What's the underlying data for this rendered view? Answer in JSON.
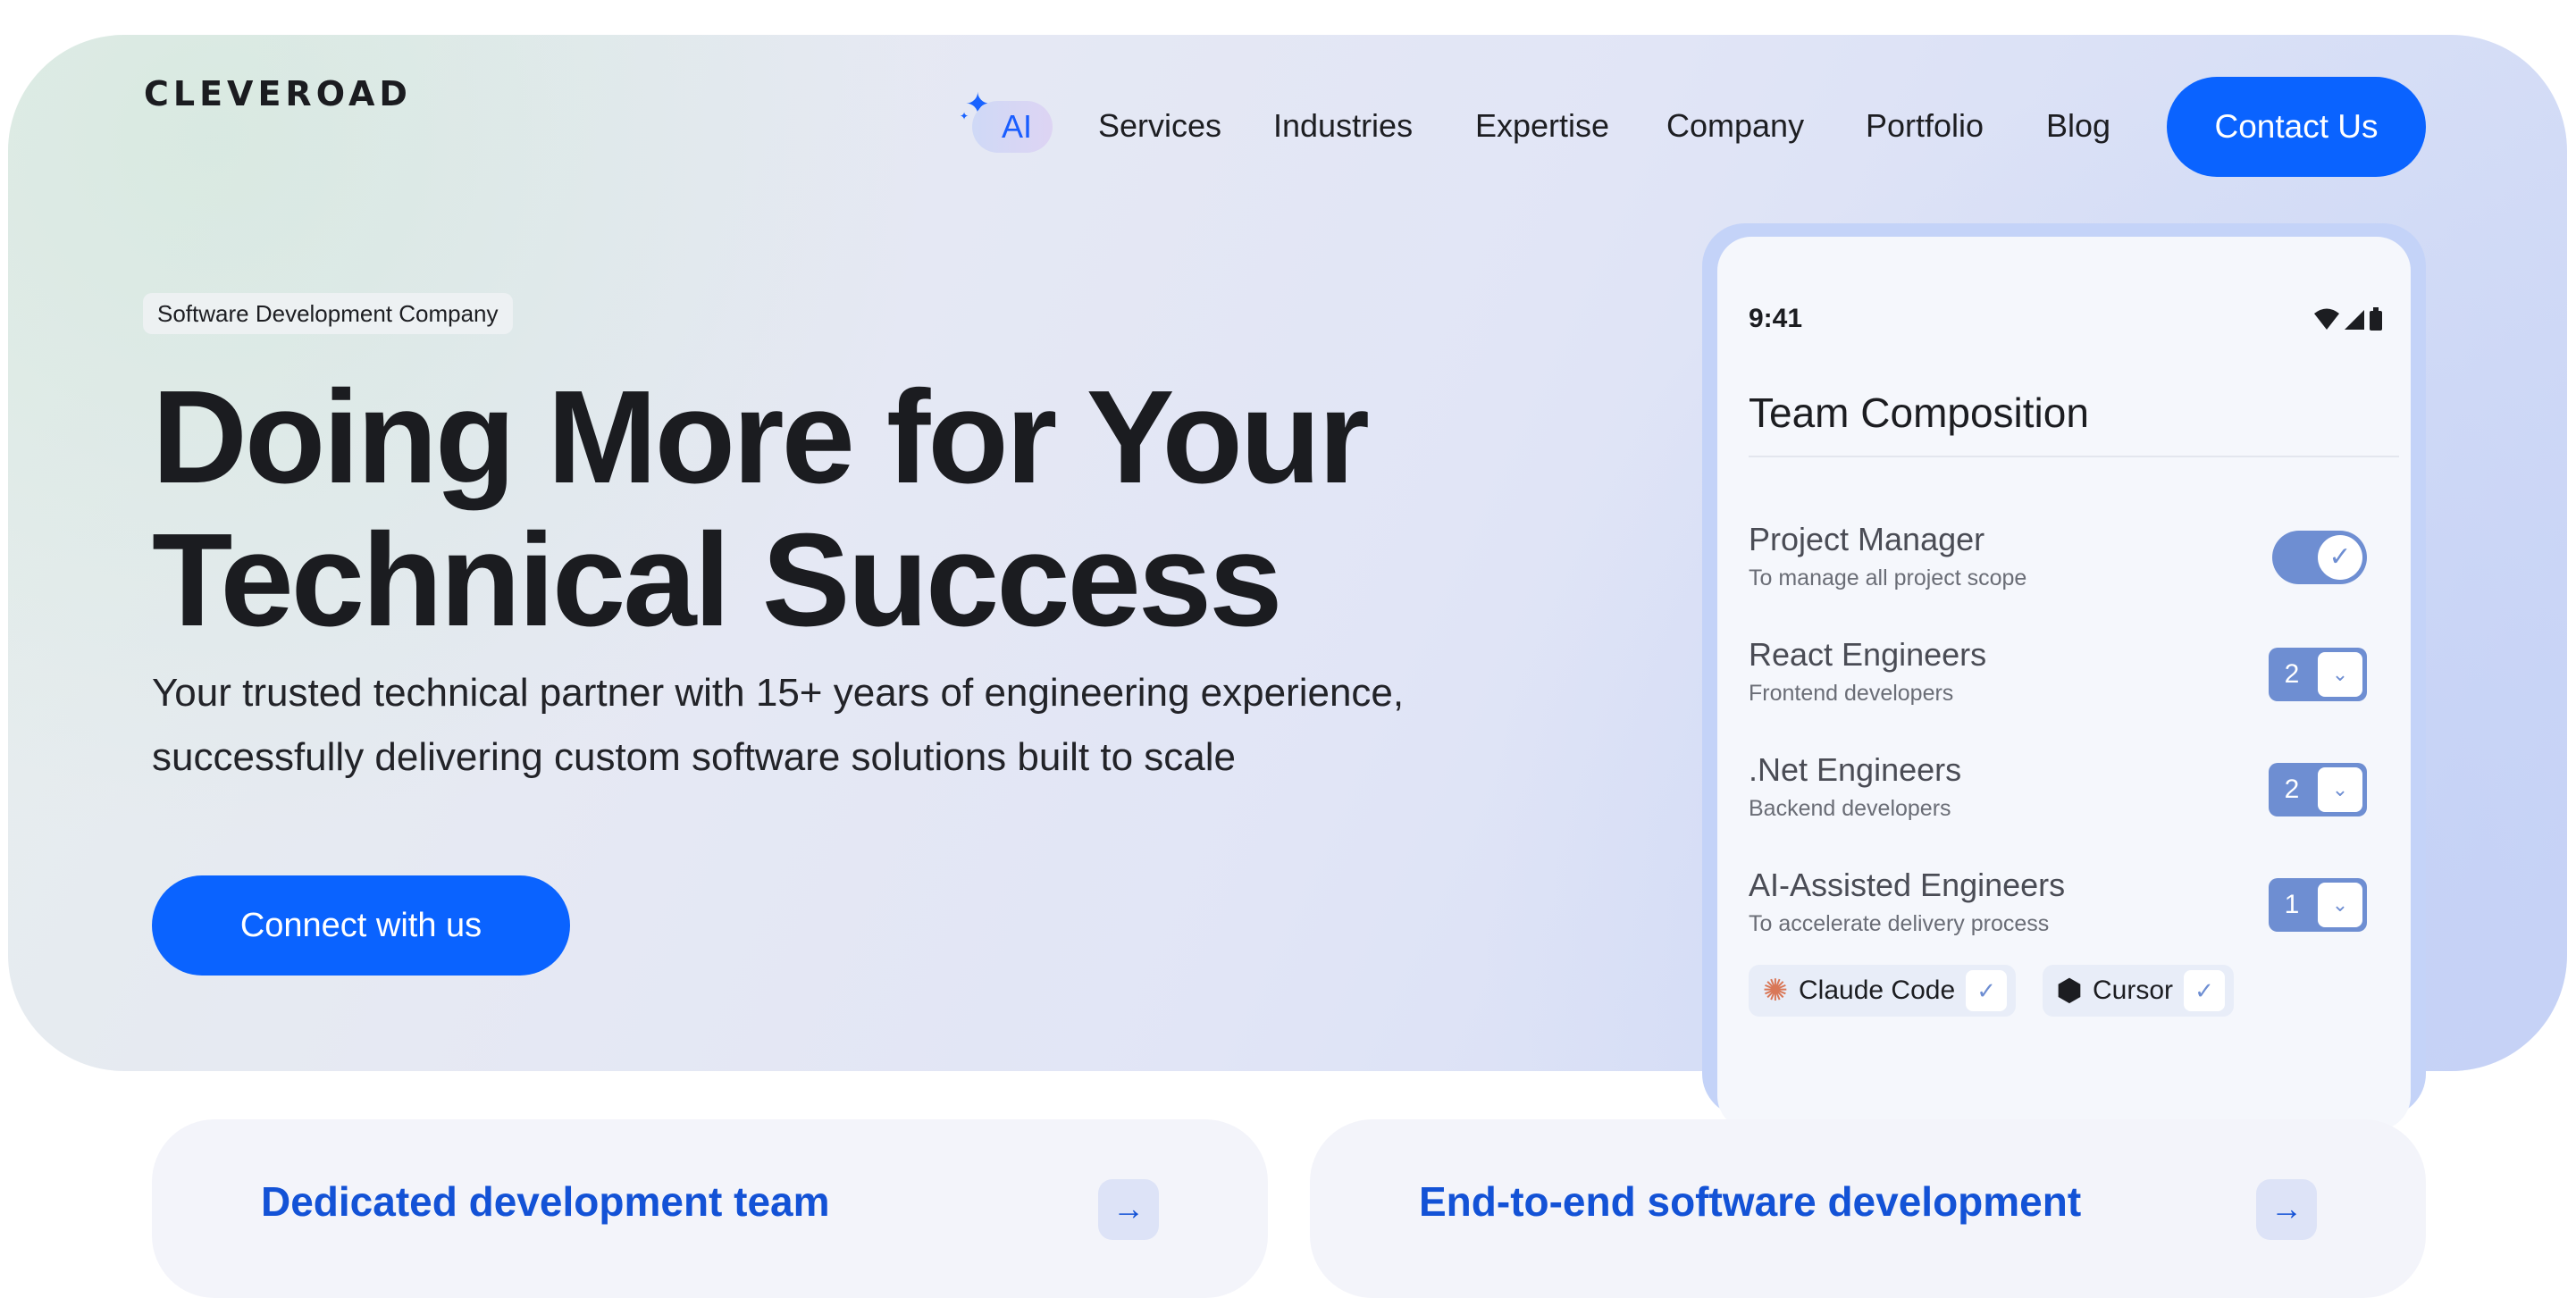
{
  "brand": {
    "logo": "CLEVEROAD"
  },
  "nav": {
    "ai_label": "AI",
    "links": [
      "Services",
      "Industries",
      "Expertise",
      "Company",
      "Portfolio",
      "Blog"
    ],
    "contact_label": "Contact Us"
  },
  "hero": {
    "eyebrow": "Software Development Company",
    "headline_line1": "Doing More for Your",
    "headline_line2": "Technical Success",
    "sub_line1": "Your trusted technical partner with 15+ years of engineering experience,",
    "sub_line2": "successfully delivering custom software solutions built to scale",
    "cta_label": "Connect with us"
  },
  "phone": {
    "status_time": "9:41",
    "title": "Team Composition",
    "roles": [
      {
        "title": "Project Manager",
        "subtitle": "To manage all project scope",
        "control": "toggle",
        "toggle_on": true
      },
      {
        "title": "React Engineers",
        "subtitle": "Frontend developers",
        "control": "stepper",
        "value": "2"
      },
      {
        "title": ".Net Engineers",
        "subtitle": "Backend developers",
        "control": "stepper",
        "value": "2"
      },
      {
        "title": "AI-Assisted Engineers",
        "subtitle": "To accelerate delivery process",
        "control": "stepper",
        "value": "1"
      }
    ],
    "tools": [
      {
        "label": "Claude Code",
        "icon": "claude-asterisk-icon",
        "checked": true
      },
      {
        "label": "Cursor",
        "icon": "cursor-cube-icon",
        "checked": true
      }
    ]
  },
  "cards": [
    {
      "title": "Dedicated development team"
    },
    {
      "title": "End-to-end software development"
    }
  ],
  "colors": {
    "accent": "#0a63ff",
    "card_title": "#1352d6",
    "control": "#6e8ed2",
    "text": "#1c1d21"
  }
}
